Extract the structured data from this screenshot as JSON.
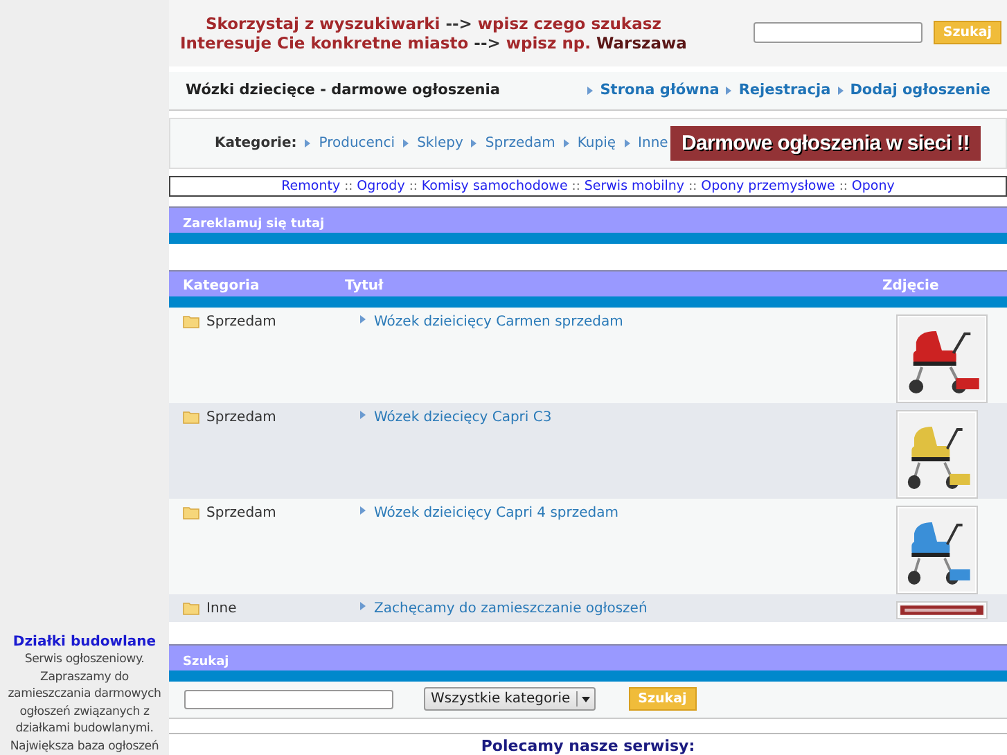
{
  "sidebar": {
    "title": "Działki budowlane",
    "text": "Serwis ogłoszeniowy. Zapraszamy do zamieszczania darmowych ogłoszeń związanych z działkami budowlanymi. Największa baza ogłoszeń"
  },
  "header": {
    "tagline": [
      [
        {
          "text": "Skorzystaj z wyszukiwarki",
          "color": "#a3282b"
        },
        {
          "text": "-->",
          "color": "#333333"
        },
        {
          "text": "wpisz czego szukasz",
          "color": "#a3282b"
        }
      ],
      [
        {
          "text": "Interesuje Cie konkretne miasto",
          "color": "#a3282b"
        },
        {
          "text": "-->",
          "color": "#333333"
        },
        {
          "text": "wpisz np.",
          "color": "#a3282b"
        },
        {
          "text": "Warszawa",
          "color": "#5a1616"
        }
      ]
    ],
    "search_button": "Szukaj"
  },
  "title_bar": {
    "title": "Wózki dziecięce - darmowe ogłoszenia",
    "nav": [
      "Strona główna",
      "Rejestracja",
      "Dodaj ogłoszenie"
    ]
  },
  "categories": {
    "label": "Kategorie:",
    "items": [
      "Producenci",
      "Sklepy",
      "Sprzedam",
      "Kupię",
      "Inne"
    ],
    "banner": "Darmowe ogłoszenia w sieci !!"
  },
  "links": [
    "Remonty",
    "Ogrody",
    "Komisy samochodowe",
    "Serwis mobilny",
    "Opony przemysłowe",
    "Opony"
  ],
  "link_separators": [
    "::",
    "::",
    "::",
    "::",
    "::"
  ],
  "ad_section": {
    "title": "Zareklamuj się tutaj"
  },
  "table": {
    "columns": [
      "Kategoria",
      "Tytuł",
      "Zdjęcie"
    ],
    "rows": [
      {
        "category": "Sprzedam",
        "title": "Wózek dzieicięcy Carmen sprzedam"
      },
      {
        "category": "Sprzedam",
        "title": "Wózek dziecięcy Capri C3"
      },
      {
        "category": "Sprzedam",
        "title": "Wózek dzieicięcy Capri 4 sprzedam"
      },
      {
        "category": "Inne",
        "title": "Zachęcamy do zamieszczanie ogłoszeń",
        "photo": {
          "kind": "banner"
        }
      }
    ]
  },
  "search": {
    "title": "Szukaj",
    "category_select": "Wszystkie kategorie",
    "button": "Szukaj"
  },
  "footer": {
    "heading": "Polecamy nasze serwisy:"
  }
}
